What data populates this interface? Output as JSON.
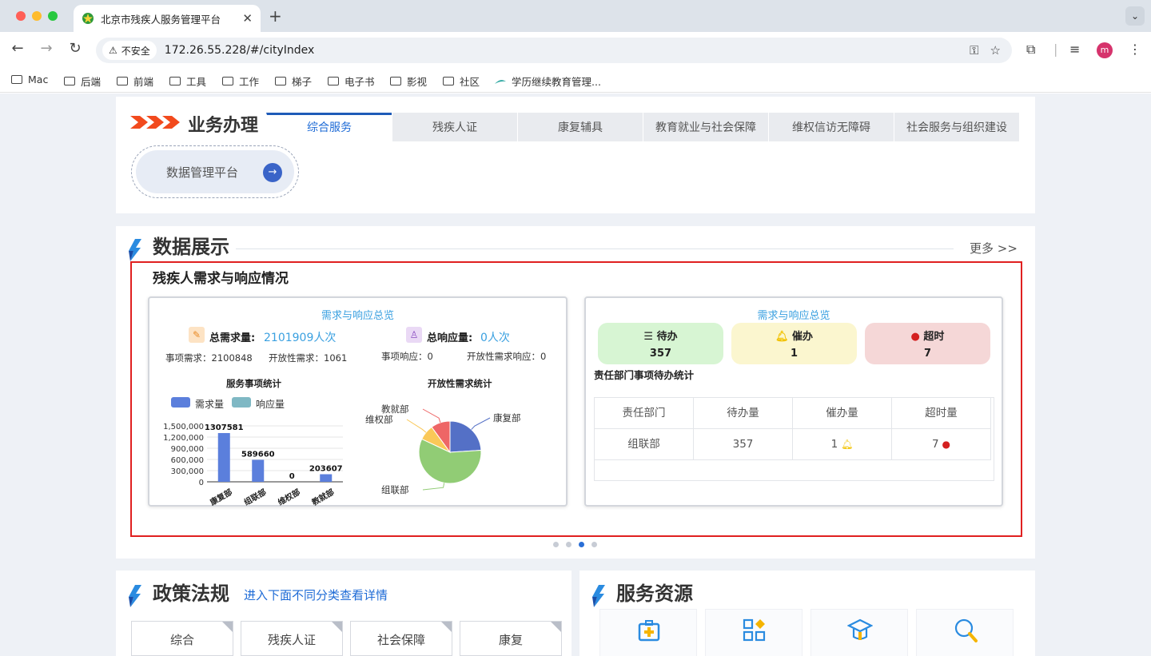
{
  "browser": {
    "tab_title": "北京市残疾人服务管理平台",
    "tab_close": "✕",
    "new_tab": "+",
    "tab_menu": "⌄",
    "security_label": "不安全",
    "url": "172.26.55.228/#/cityIndex",
    "avatar_letter": "m",
    "bookmarks": [
      "Mac",
      "后端",
      "前端",
      "工具",
      "工作",
      "梯子",
      "电子书",
      "影视",
      "社区",
      "学历继续教育管理..."
    ]
  },
  "business": {
    "title": "业务办理",
    "tabs": [
      "综合服务",
      "残疾人证",
      "康复辅具",
      "教育就业与社会保障",
      "维权信访无障碍",
      "社会服务与组织建设"
    ],
    "active_tab": 0,
    "platform_button": "数据管理平台"
  },
  "data_display": {
    "title": "数据展示",
    "more": "更多 >>",
    "subtitle": "残疾人需求与响应情况",
    "left_card": {
      "title": "需求与响应总览",
      "total_demand_label": "总需求量:",
      "total_demand_value": "2101909人次",
      "total_response_label": "总响应量:",
      "total_response_value": "0人次",
      "item_demand": "事项需求：2100848",
      "open_demand": "开放性需求：1061",
      "item_response": "事项响应：0",
      "open_response": "开放性需求响应：0",
      "bar_chart_title": "服务事项统计",
      "pie_chart_title": "开放性需求统计",
      "legend": [
        "需求量",
        "响应量"
      ]
    },
    "right_card": {
      "title": "需求与响应总览",
      "statuses": [
        {
          "label": "待办",
          "value": "357",
          "icon": "list-icon",
          "bg": "#d7f5d3"
        },
        {
          "label": "催办",
          "value": "1",
          "icon": "bell-icon",
          "bg": "#fbf6cf"
        },
        {
          "label": "超时",
          "value": "7",
          "icon": "clock-icon",
          "bg": "#f5d7d7"
        }
      ],
      "dept_title": "责任部门事项待办统计",
      "table_headers": [
        "责任部门",
        "待办量",
        "催办量",
        "超时量"
      ],
      "table_row": [
        "组联部",
        "357",
        "1",
        "7"
      ]
    },
    "carousel_dots": 4,
    "carousel_active": 2
  },
  "chart_data": [
    {
      "type": "bar",
      "title": "服务事项统计",
      "categories": [
        "康复部",
        "组联部",
        "维权部",
        "教就部"
      ],
      "series": [
        {
          "name": "需求量",
          "values": [
            1307581,
            589660,
            0,
            203607
          ],
          "color": "#5b7fdc"
        },
        {
          "name": "响应量",
          "values": [
            0,
            0,
            0,
            0
          ],
          "color": "#7fb8c4"
        }
      ],
      "data_labels": [
        "1307581",
        "589660",
        "0",
        "203607"
      ],
      "ylim": [
        0,
        1500000
      ],
      "yticks": [
        "0",
        "300,000",
        "600,000",
        "900,000",
        "1,200,000",
        "1,500,000"
      ],
      "legend": "top"
    },
    {
      "type": "pie",
      "title": "开放性需求统计",
      "labels": [
        "康复部",
        "组联部",
        "维权部",
        "教就部"
      ],
      "values": [
        24,
        58,
        8,
        10
      ],
      "colors": [
        "#5470c6",
        "#91cc75",
        "#fac858",
        "#ee6666"
      ]
    }
  ],
  "policy": {
    "title": "政策法规",
    "link": "进入下面不同分类查看详情",
    "categories": [
      "综合",
      "残疾人证",
      "社会保障",
      "康复"
    ]
  },
  "resources": {
    "title": "服务资源",
    "icons": [
      "medical-kit-icon",
      "apps-grid-icon",
      "graduation-cap-icon",
      "job-search-icon"
    ]
  },
  "colors": {
    "accent_blue": "#1e6bd6",
    "frame_red": "#e02020",
    "page_bg": "#eef1f6"
  }
}
